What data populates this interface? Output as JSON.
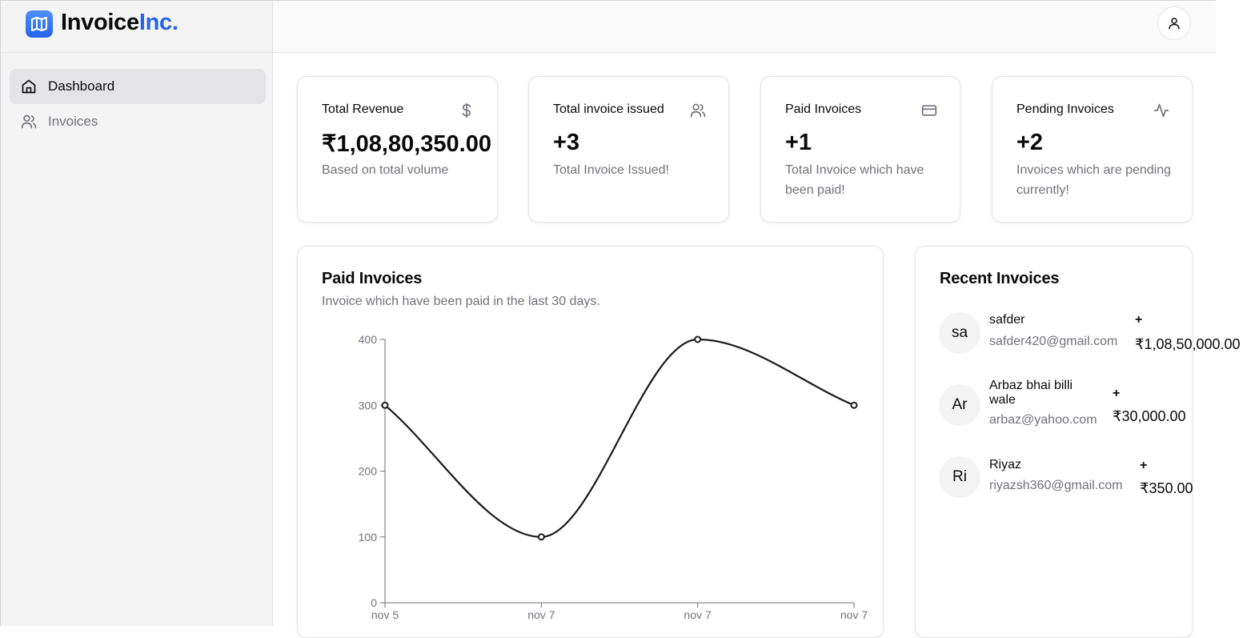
{
  "brand": {
    "name_main": "Invoice",
    "name_accent": "Inc.",
    "logo_icon": "book-map-icon",
    "accent_color": "#2563eb"
  },
  "sidebar": {
    "items": [
      {
        "label": "Dashboard",
        "icon": "home-icon",
        "active": true
      },
      {
        "label": "Invoices",
        "icon": "users-icon",
        "active": false
      }
    ]
  },
  "header": {
    "user_icon": "user-icon"
  },
  "stats": [
    {
      "title": "Total Revenue",
      "value": "₹1,08,80,350.00",
      "desc": "Based on total volume",
      "icon": "dollar-icon"
    },
    {
      "title": "Total invoice issued",
      "value": "+3",
      "desc": "Total Invoice Issued!",
      "icon": "users-icon"
    },
    {
      "title": "Paid Invoices",
      "value": "+1",
      "desc": "Total Invoice which have been paid!",
      "icon": "credit-card-icon"
    },
    {
      "title": "Pending Invoices",
      "value": "+2",
      "desc": "Invoices which are pending currently!",
      "icon": "activity-icon"
    }
  ],
  "paid_chart": {
    "title": "Paid Invoices",
    "subtitle": "Invoice which have been paid in the last 30 days."
  },
  "chart_data": {
    "type": "line",
    "title": "Paid Invoices",
    "categories": [
      "nov 5",
      "nov 7",
      "nov 7",
      "nov 7"
    ],
    "values": [
      300,
      100,
      400,
      300
    ],
    "ylim": [
      0,
      400
    ],
    "yticks": [
      0,
      100,
      200,
      300,
      400
    ],
    "xlabel": "",
    "ylabel": "",
    "grid": false,
    "line_color": "#1a1a1a"
  },
  "recent": {
    "title": "Recent Invoices",
    "items": [
      {
        "initials": "sa",
        "name": "safder",
        "email": "safder420@gmail.com",
        "plus": "+",
        "amount": "₹1,08,50,000.00"
      },
      {
        "initials": "Ar",
        "name": "Arbaz bhai billi wale",
        "email": "arbaz@yahoo.com",
        "plus": "+",
        "amount": "₹30,000.00"
      },
      {
        "initials": "Ri",
        "name": "Riyaz",
        "email": "riyazsh360@gmail.com",
        "plus": "+",
        "amount": "₹350.00"
      }
    ]
  }
}
